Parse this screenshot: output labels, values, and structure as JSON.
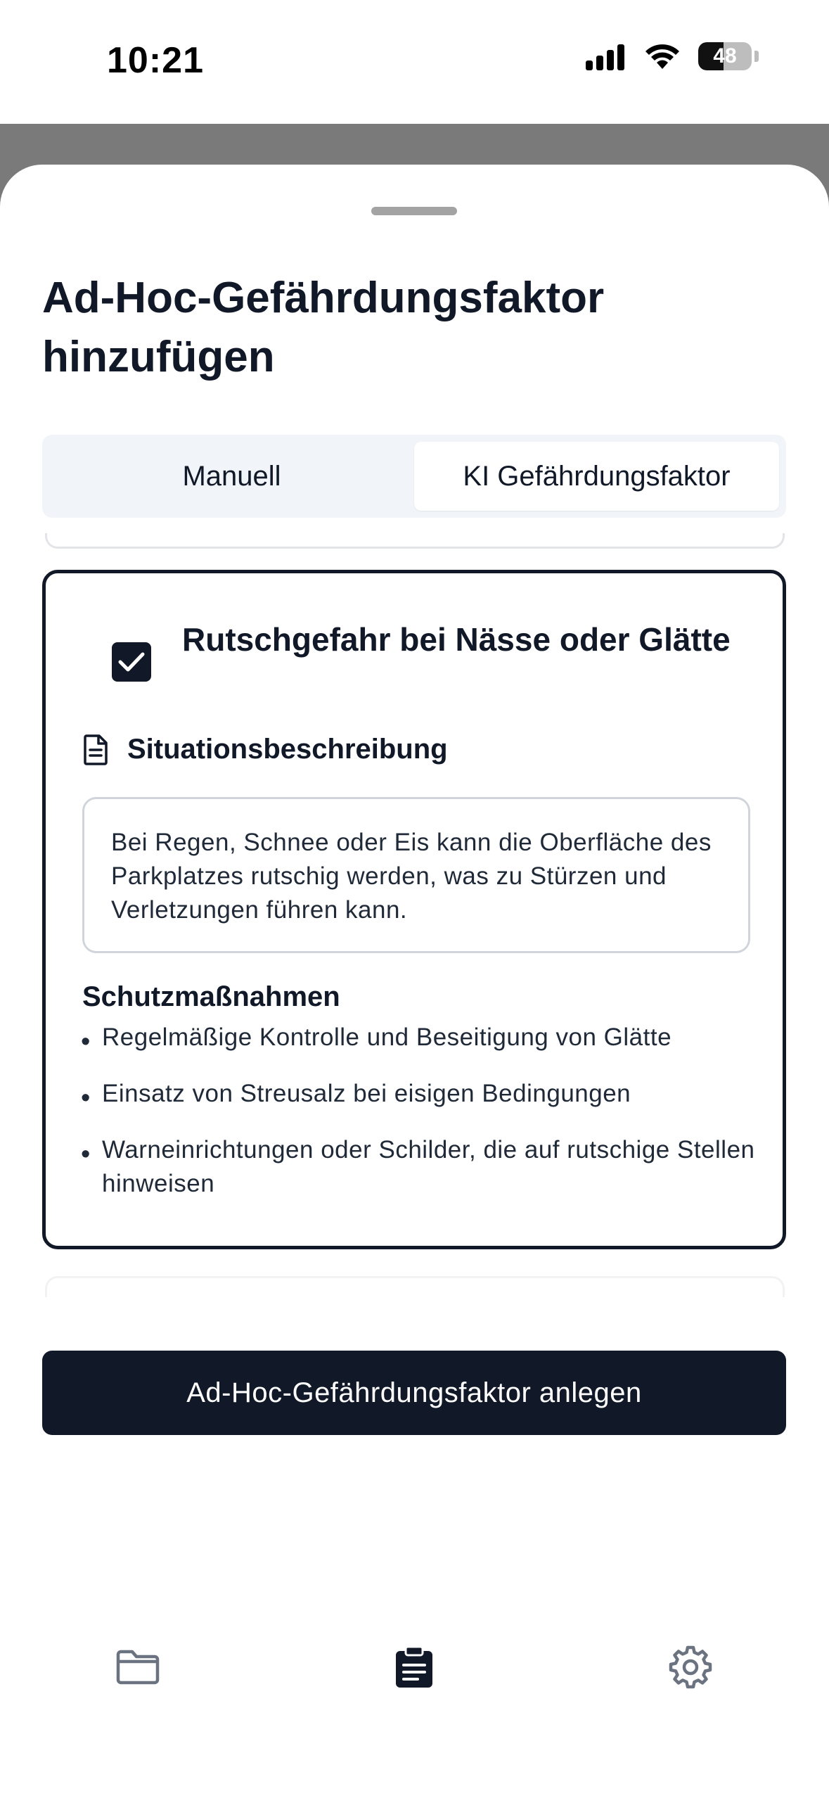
{
  "status_bar": {
    "time": "10:21",
    "battery_percent": "48",
    "battery_level": 0.48
  },
  "sheet": {
    "title": "Ad-Hoc-Gefährdungsfaktor hinzufügen",
    "tabs": [
      {
        "label": "Manuell",
        "active": false
      },
      {
        "label": "KI Gefährdungsfaktor",
        "active": true
      }
    ]
  },
  "hazard": {
    "checked": true,
    "title": "Rutschgefahr bei Nässe oder Glätte",
    "description_heading": "Situationsbeschreibung",
    "description": "Bei Regen, Schnee oder Eis kann die Oberfläche des Parkplatzes rutschig werden, was zu Stürzen und Verletzungen führen kann.",
    "measures_heading": "Schutzmaßnahmen",
    "measures": [
      "Regelmäßige Kontrolle und Beseitigung von Glätte",
      "Einsatz von Streusalz bei eisigen Bedingungen",
      "Warneinrichtungen oder Schilder, die auf rutschige Stellen hinweisen"
    ]
  },
  "actions": {
    "create_label": "Ad-Hoc-Gefährdungsfaktor anlegen"
  },
  "tab_bar": {
    "items": [
      {
        "icon": "folder-icon",
        "active": false
      },
      {
        "icon": "clipboard-icon",
        "active": true
      },
      {
        "icon": "gear-icon",
        "active": false
      }
    ]
  },
  "colors": {
    "primary": "#111827",
    "inactive_icon": "#6b7280",
    "segment_bg": "#f1f4f8"
  }
}
